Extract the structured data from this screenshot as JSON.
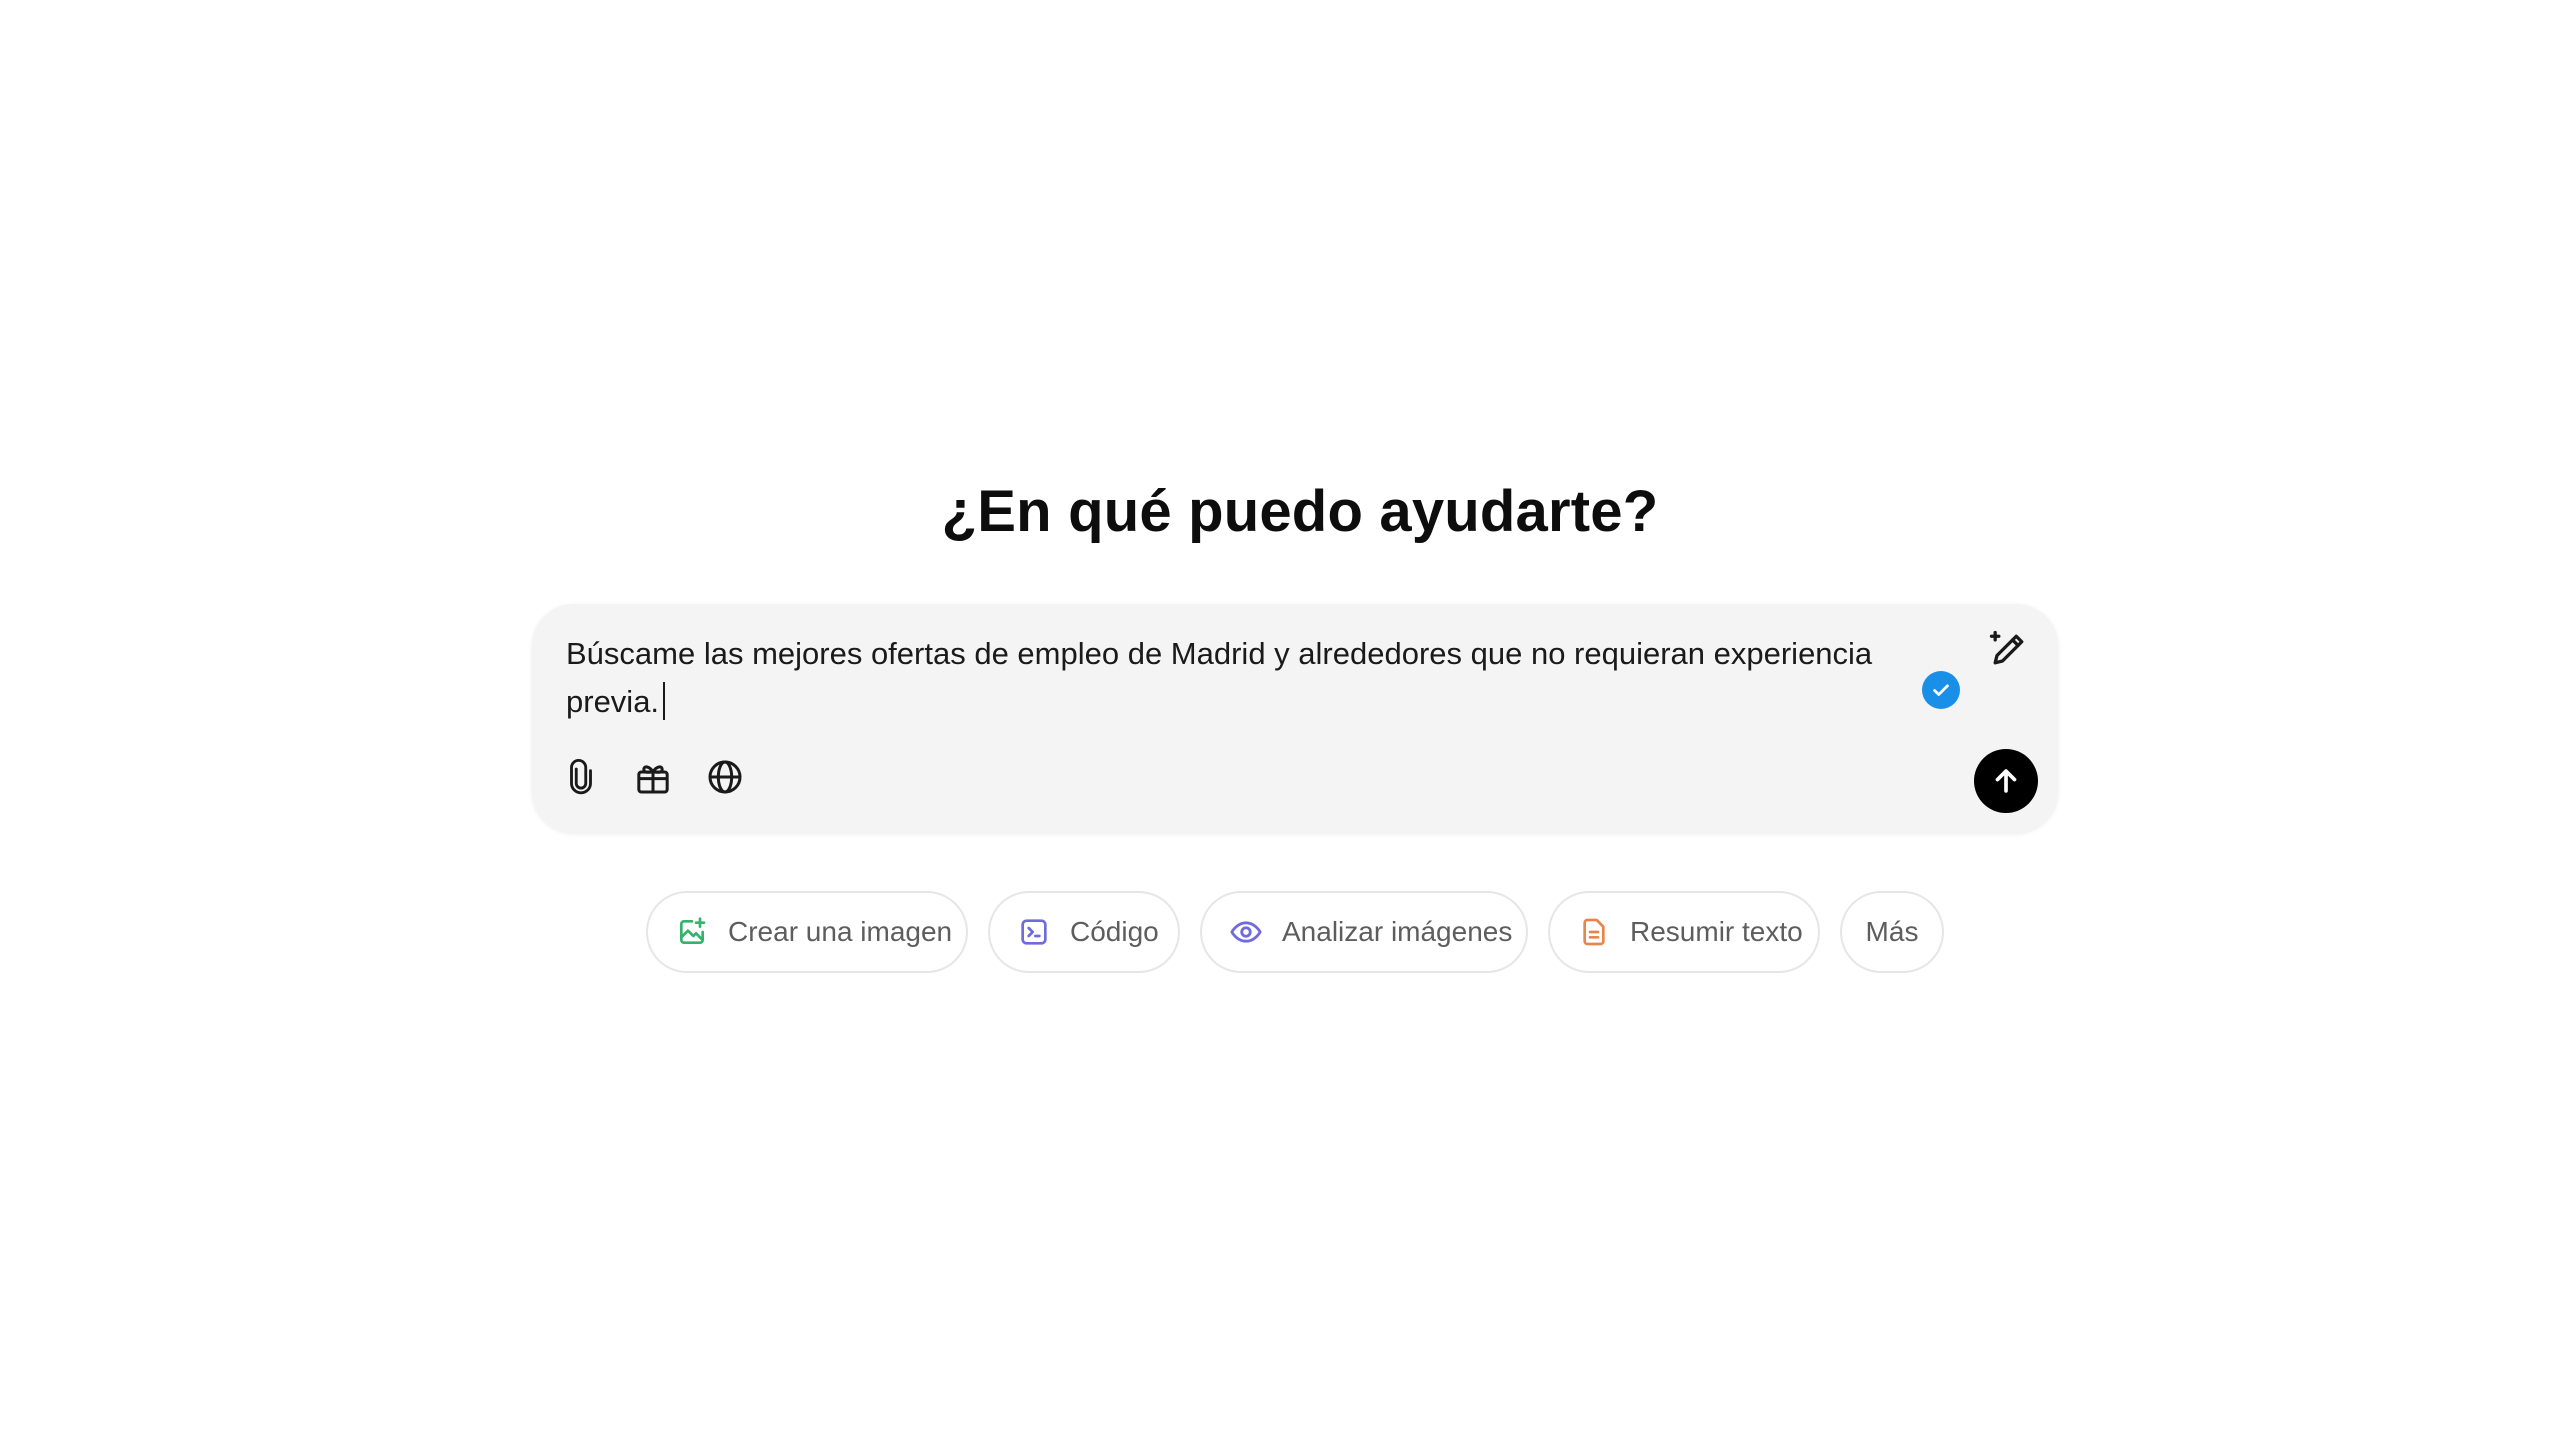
{
  "headline": "¿En qué puedo ayudarte?",
  "composer": {
    "text_line1": "Búscame las mejores ofertas de empleo de Madrid y alrededores que no requieran experiencia",
    "text_line2": "previa.",
    "icons": {
      "magic_edit": "pencil-sparkle-icon",
      "grammar_check": "check-badge-icon",
      "attach": "paperclip-icon",
      "tools": "gift-box-icon",
      "search": "globe-icon",
      "send": "arrow-up-icon"
    }
  },
  "suggestions": [
    {
      "label": "Crear una imagen",
      "icon": "image-plus-icon",
      "color": "#35b36b"
    },
    {
      "label": "Código",
      "icon": "terminal-icon",
      "color": "#6f6bdc"
    },
    {
      "label": "Analizar imágenes",
      "icon": "eye-icon",
      "color": "#6f6bdc"
    },
    {
      "label": "Resumir texto",
      "icon": "document-icon",
      "color": "#e8864a"
    },
    {
      "label": "Más",
      "icon": "",
      "color": ""
    }
  ],
  "colors": {
    "accent_blue": "#1a8fe8",
    "composer_bg": "#f4f4f4",
    "send_bg": "#000000"
  }
}
